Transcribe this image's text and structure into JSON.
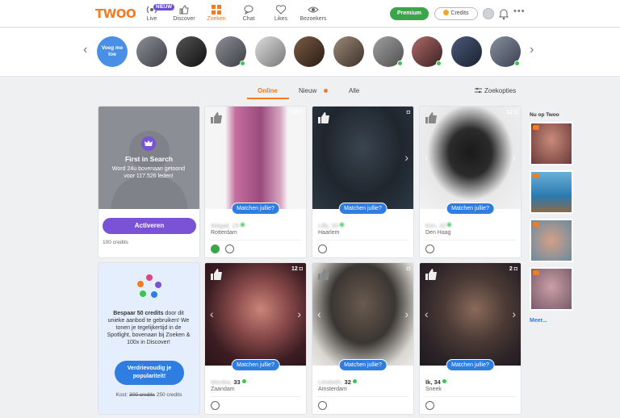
{
  "nav": {
    "logo": "TWOO",
    "live_badge": "NIEUW",
    "items": [
      {
        "label": "Live",
        "icon": "live-icon"
      },
      {
        "label": "Discover",
        "icon": "thumbs-up-icon"
      },
      {
        "label": "Zoeken",
        "icon": "grid-icon"
      },
      {
        "label": "Chat",
        "icon": "chat-icon"
      },
      {
        "label": "Likes",
        "icon": "heart-icon"
      },
      {
        "label": "Bezoekers",
        "icon": "eye-icon"
      }
    ],
    "premium": "Premium",
    "credits": "Credits",
    "accent": "#f47b20"
  },
  "stories": {
    "me_label": "Voeg me toe"
  },
  "tabs": {
    "items": [
      "Online",
      "Nieuw",
      "Alle"
    ],
    "filters": "Zoekopties"
  },
  "promo": {
    "title": "First in Search",
    "subtitle": "Word 24u bovenaan getoond voor 117.526 leden!",
    "button": "Activeren",
    "cost": "100 credits"
  },
  "spotlight": {
    "text_bold": "Bespaar 50 credits",
    "text_rest": " door dit unieke aanbod te gebruiken! We tonen je tegelijkertijd in de Spotlight, bovenaan bij Zoeken & 100x in Discover!",
    "button": "Verdrievoudig je populariteit!",
    "cost_label": "Kost:",
    "cost_old": "300 credits",
    "cost_new": "250 credits"
  },
  "match_label": "Matchen jullie?",
  "profiles": [
    {
      "name": "Abigail, 25",
      "age": "",
      "city": "Rotterdam",
      "photos": "12"
    },
    {
      "name": "Lilly, 30",
      "age": "",
      "city": "Haarlem",
      "photos": ""
    },
    {
      "name": "Kim, 32",
      "age": "",
      "city": "Den Haag",
      "photos": "12"
    },
    {
      "name": "Monika,",
      "age": "33",
      "city": "Zaandam",
      "photos": "12"
    },
    {
      "name": "Liesbeth,",
      "age": "32",
      "city": "Amsterdam",
      "photos": ""
    },
    {
      "name": "Ik,",
      "age": "34",
      "city": "Sneek",
      "photos": "2"
    }
  ],
  "rail": {
    "title": "Nu op Twoo",
    "more": "Meer..."
  }
}
